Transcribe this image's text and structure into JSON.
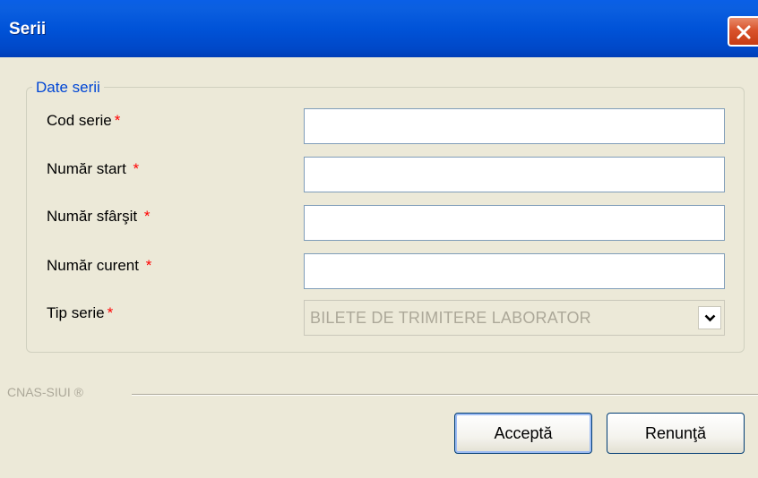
{
  "window": {
    "title": "Serii"
  },
  "group": {
    "legend": "Date serii"
  },
  "fields": {
    "cod_serie": {
      "label": "Cod serie",
      "required_mark": "*",
      "value": ""
    },
    "numar_start": {
      "label": "Număr start",
      "required_mark": "*",
      "value": ""
    },
    "numar_sfarsit": {
      "label": "Număr sfârşit",
      "required_mark": "*",
      "value": ""
    },
    "numar_curent": {
      "label": "Număr curent",
      "required_mark": "*",
      "value": ""
    },
    "tip_serie": {
      "label": "Tip serie",
      "required_mark": "*",
      "selected": "BILETE DE TRIMITERE LABORATOR",
      "disabled": true
    }
  },
  "footer": {
    "brand": "CNAS-SIUI ®"
  },
  "buttons": {
    "accept": "Acceptă",
    "cancel": "Renunţă"
  },
  "colors": {
    "titlebar": "#0053d8",
    "window_bg": "#ece9d8",
    "legend": "#0046d5",
    "required": "#ff0000",
    "close_button": "#d9532c"
  },
  "icons": {
    "close": "close-icon",
    "dropdown": "chevron-down-icon"
  }
}
